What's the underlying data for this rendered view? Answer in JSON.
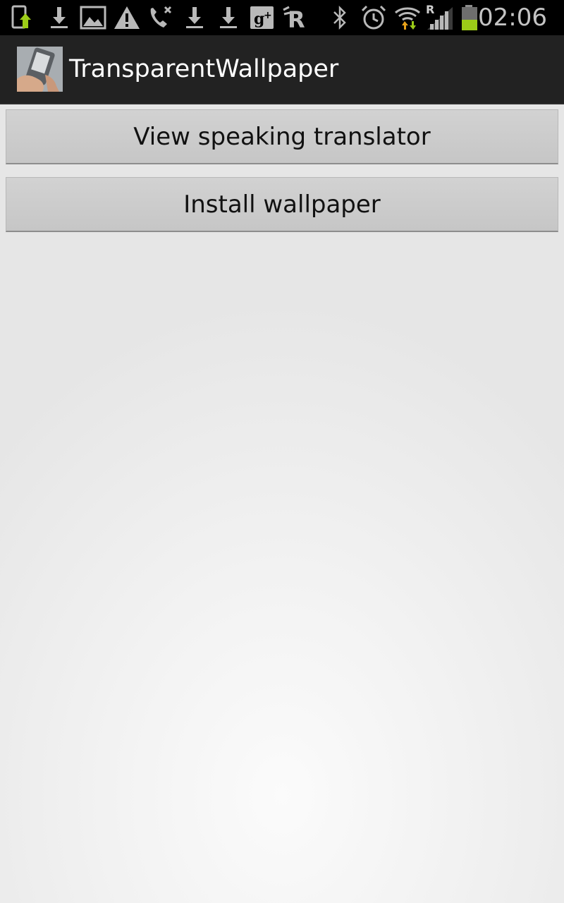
{
  "status_bar": {
    "time": "02:06",
    "roaming_indicator": "R",
    "icons": [
      "phone-update-icon",
      "download-icon",
      "image-icon",
      "warning-icon",
      "missed-call-icon",
      "download-icon",
      "download-icon",
      "google-plus-icon",
      "r-app-icon",
      "bluetooth-icon",
      "alarm-icon",
      "wifi-icon",
      "signal-icon",
      "battery-icon"
    ],
    "accent_color": "#9ccc18"
  },
  "action_bar": {
    "title": "TransparentWallpaper"
  },
  "buttons": {
    "view_translator": "View speaking translator",
    "install_wallpaper": "Install wallpaper"
  }
}
